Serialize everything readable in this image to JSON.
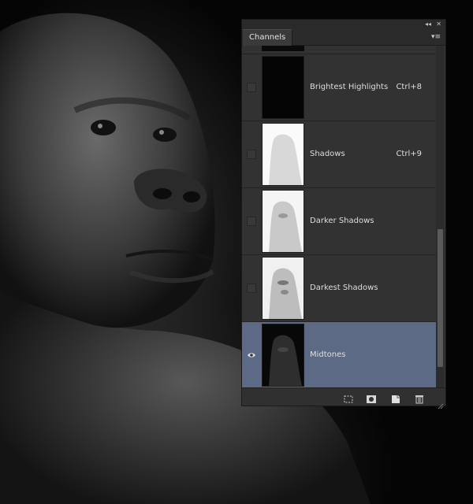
{
  "panel": {
    "title_tab": "Channels",
    "channels": [
      {
        "name": "Brightest Highlights",
        "shortcut": "Ctrl+8",
        "visible": false,
        "selected": false,
        "thumb": "dark"
      },
      {
        "name": "Shadows",
        "shortcut": "Ctrl+9",
        "visible": false,
        "selected": false,
        "thumb": "light"
      },
      {
        "name": "Darker Shadows",
        "shortcut": "",
        "visible": false,
        "selected": false,
        "thumb": "light"
      },
      {
        "name": "Darkest Shadows",
        "shortcut": "",
        "visible": false,
        "selected": false,
        "thumb": "light"
      },
      {
        "name": "Midtones",
        "shortcut": "",
        "visible": true,
        "selected": true,
        "thumb": "dark-gorilla"
      }
    ],
    "icons": {
      "collapse": "double-chevron-left-icon",
      "close": "close-icon",
      "menu": "panel-menu-icon",
      "footer": [
        "load-channel-as-selection-icon",
        "save-selection-as-channel-icon",
        "new-channel-icon",
        "delete-channel-icon"
      ]
    },
    "colors": {
      "selected_row": "#5d6a85",
      "panel_bg": "#323232"
    }
  }
}
